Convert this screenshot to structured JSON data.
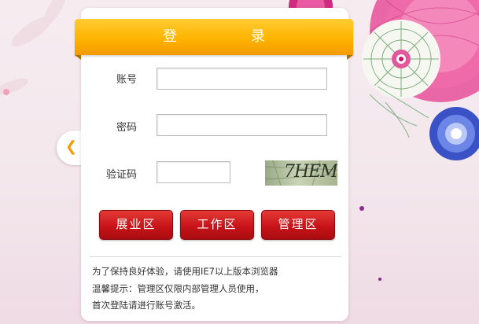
{
  "login": {
    "title": "登 录",
    "account_label": "账号",
    "password_label": "密码",
    "captcha_label": "验证码",
    "account_value": "",
    "password_value": "",
    "captcha_value": "",
    "captcha_text": "7HEM"
  },
  "buttons": {
    "exhibit": "展业区",
    "work": "工作区",
    "manage": "管理区"
  },
  "notes": {
    "line1": "为了保持良好体验，请使用IE7以上版本浏览器",
    "line2": "温馨提示：管理区仅限内部管理人员使用，",
    "line3": "首次登陆请进行账号激活。"
  },
  "icons": {
    "side_arrow": "chevron-left-icon"
  },
  "colors": {
    "header": "#ffb400",
    "button": "#c8141a",
    "arrow": "#f39a00"
  }
}
